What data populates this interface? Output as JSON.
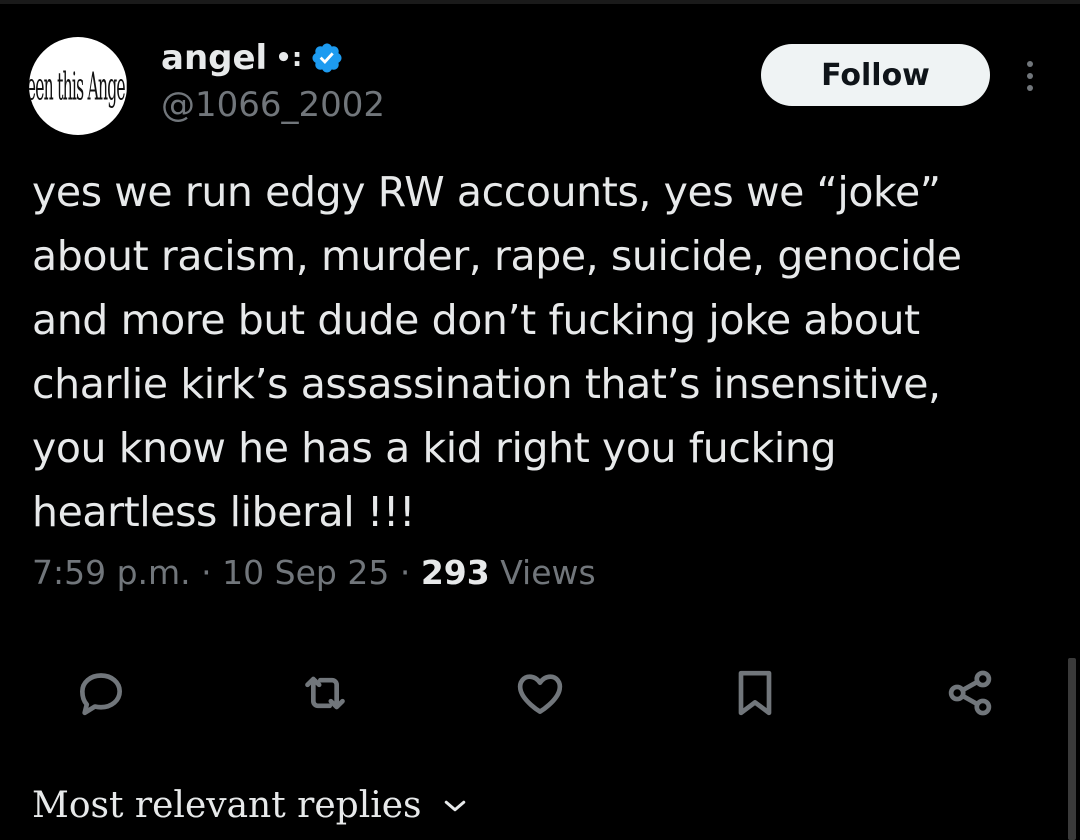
{
  "author": {
    "avatar_text": "seen this Angel?",
    "display_name": "angel",
    "name_suffix": "•:",
    "handle": "@1066_2002",
    "verified": true
  },
  "follow_button": {
    "label": "Follow"
  },
  "tweet": {
    "text": "yes we run edgy RW accounts, yes we “joke”\nabout racism, murder, rape, suicide, genocide\nand more but dude don’t fucking joke about\ncharlie kirk’s assassination that’s insensitive,\nyou know he has a kid right you fucking\nheartless liberal !!!",
    "time": "7:59 p.m.",
    "date": "10 Sep 25",
    "views_count": "293",
    "views_label": "Views"
  },
  "actions": [
    "reply-icon",
    "retweet-icon",
    "like-icon",
    "bookmark-icon",
    "share-icon"
  ],
  "replies": {
    "label": "Most relevant replies"
  },
  "colors": {
    "background": "#000000",
    "text": "#e7e9ea",
    "muted": "#71767b",
    "verified": "#1d9bf0",
    "button_bg": "#eff3f4"
  }
}
